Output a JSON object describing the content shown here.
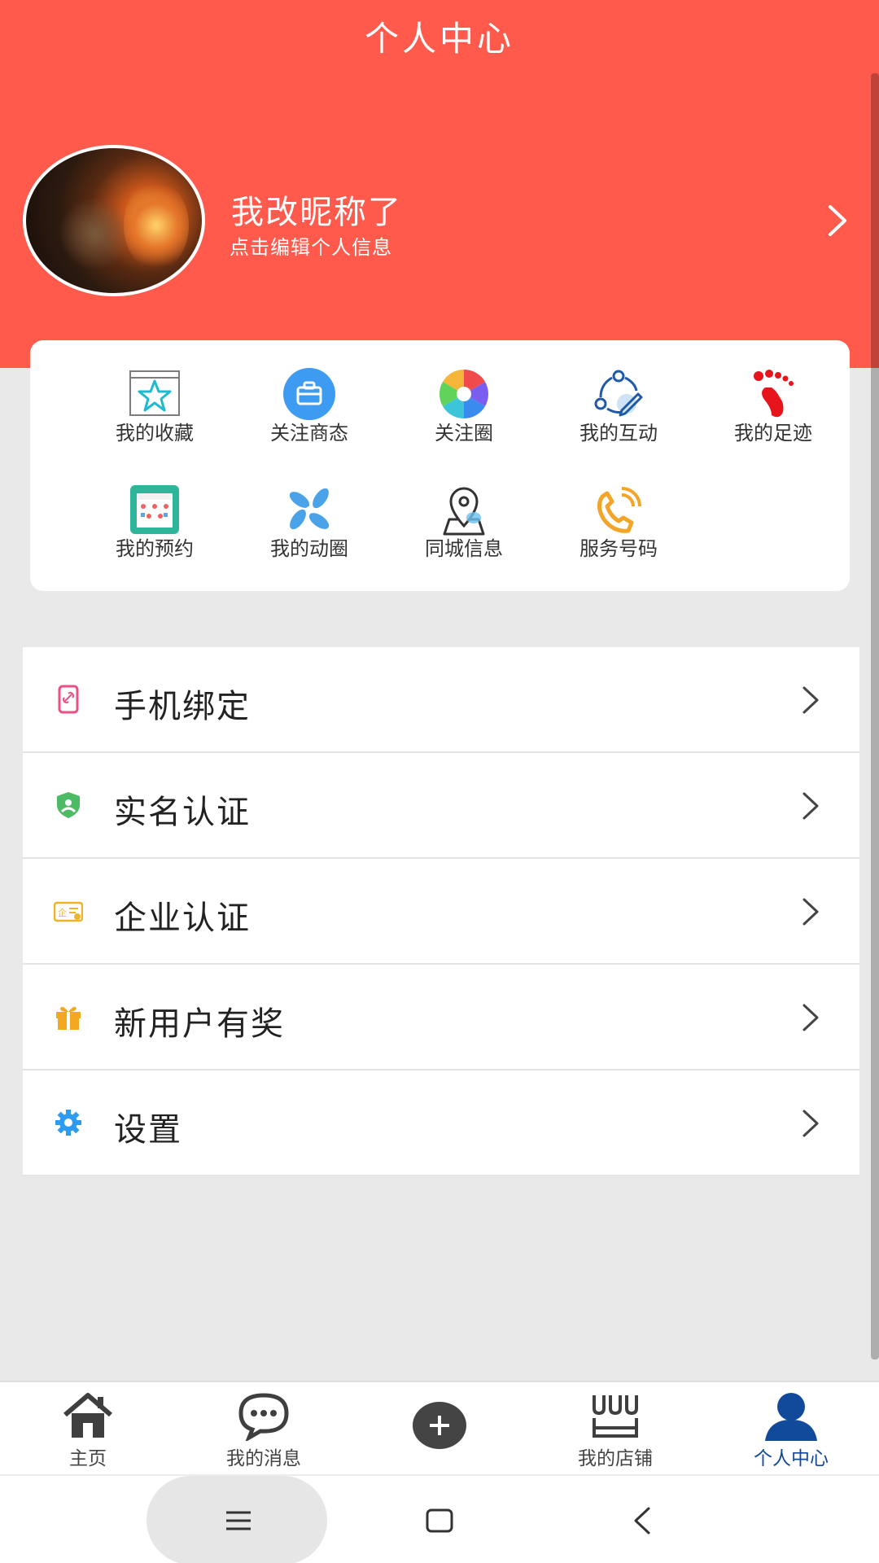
{
  "header": {
    "title": "个人中心"
  },
  "profile": {
    "nickname": "我改昵称了",
    "edit_hint": "点击编辑个人信息"
  },
  "quick_actions": [
    {
      "label": "我的收藏",
      "icon": "star-icon"
    },
    {
      "label": "关注商态",
      "icon": "briefcase-icon"
    },
    {
      "label": "关注圈",
      "icon": "aperture-icon"
    },
    {
      "label": "我的互动",
      "icon": "interaction-icon"
    },
    {
      "label": "我的足迹",
      "icon": "footprint-icon"
    },
    {
      "label": "我的预约",
      "icon": "calendar-icon"
    },
    {
      "label": "我的动圈",
      "icon": "pinwheel-icon"
    },
    {
      "label": "同城信息",
      "icon": "location-pin-icon"
    },
    {
      "label": "服务号码",
      "icon": "phone-icon"
    }
  ],
  "menu": [
    {
      "label": "手机绑定",
      "icon": "phone-link-icon"
    },
    {
      "label": "实名认证",
      "icon": "shield-user-icon"
    },
    {
      "label": "企业认证",
      "icon": "enterprise-badge-icon"
    },
    {
      "label": "新用户有奖",
      "icon": "gift-icon"
    },
    {
      "label": "设置",
      "icon": "gear-icon"
    }
  ],
  "tabbar": {
    "items": [
      {
        "label": "主页",
        "icon": "home-icon"
      },
      {
        "label": "我的消息",
        "icon": "message-icon"
      },
      {
        "label": "",
        "icon": "add-icon"
      },
      {
        "label": "我的店铺",
        "icon": "shop-icon"
      },
      {
        "label": "个人中心",
        "icon": "user-icon"
      }
    ]
  },
  "colors": {
    "accent": "#ff5a4b",
    "tab_active": "#124a9b"
  }
}
